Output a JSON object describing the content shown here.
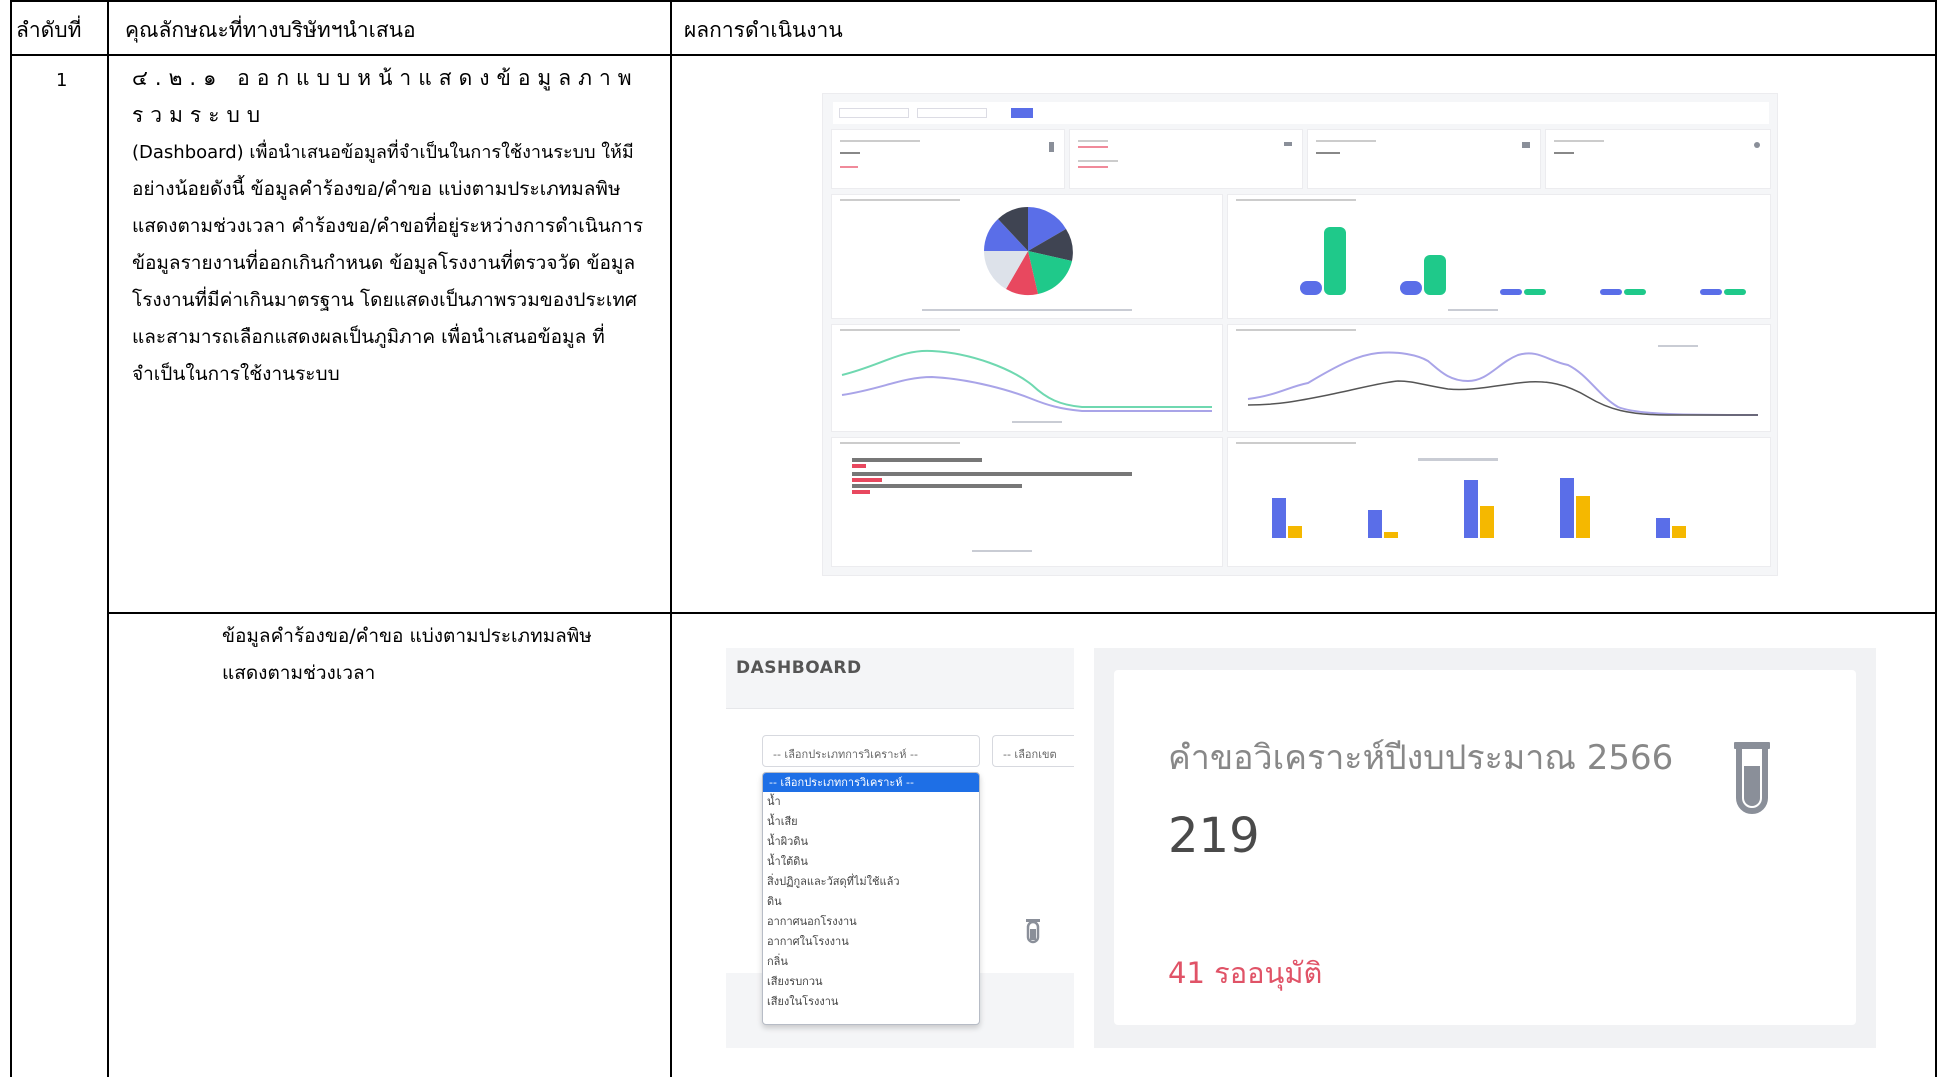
{
  "table": {
    "headers": {
      "no": "ลำดับที่",
      "feature": "คุณลักษณะที่ทางบริษัทฯนำเสนอ",
      "result": "ผลการดำเนินงาน"
    },
    "row1": {
      "no": "1",
      "lines": [
        "๔.๒.๑ ออกแบบหน้าแสดงข้อมูลภาพรวมระบบ",
        "(Dashboard) เพื่อนำเสนอข้อมูลที่จำเป็นในการใช้งานระบบ ให้มี",
        "อย่างน้อยดังนี้ ข้อมูลคำร้องขอ/คำขอ แบ่งตามประเภทมลพิษ",
        "แสดงตามช่วงเวลา คำร้องขอ/คำขอที่อยู่ระหว่างการดำเนินการ",
        "ข้อมูลรายงานที่ออกเกินกำหนด ข้อมูลโรงงานที่ตรวจวัด ข้อมูล",
        "โรงงานที่มีค่าเกินมาตรฐาน โดยแสดงเป็นภาพรวมของประเทศ",
        "และสามารถเลือกแสดงผลเป็นภูมิภาค เพื่อนำเสนอข้อมูล ที่",
        "จำเป็นในการใช้งานระบบ"
      ]
    },
    "row2": {
      "lines": [
        "ข้อมูลคำร้องขอ/คำขอ แบ่งตามประเภทมลพิษ",
        "แสดงตามช่วงเวลา"
      ]
    }
  },
  "dashboard_zoom": {
    "title": "DASHBOARD",
    "select_placeholder": "-- เลือกประเภทการวิเคราะห์ --",
    "select2_placeholder": "-- เลือกเขต",
    "dropdown_selected": "-- เลือกประเภทการวิเคราะห์ --",
    "dropdown_options": [
      "น้ำ",
      "น้ำเสีย",
      "น้ำผิวดิน",
      "น้ำใต้ดิน",
      "สิ่งปฏิกูลและวัสดุที่ไม่ใช้แล้ว",
      "ดิน",
      "อากาศนอกโรงงาน",
      "อากาศในโรงงาน",
      "กลิ่น",
      "เสียงรบกวน",
      "เสียงในโรงงาน"
    ],
    "card": {
      "label": "คำขอวิเคราะห์ปีงบประมาณ 2566",
      "value": "219",
      "pending": "41 รออนุมัติ"
    }
  },
  "colors": {
    "accent_blue": "#5a6ee8",
    "accent_green": "#1fc98a",
    "accent_yellow": "#f5b800",
    "accent_red": "#e8485f",
    "dark": "#3f4452",
    "select_highlight": "#1e6fe6",
    "pending_red": "#e05367"
  }
}
